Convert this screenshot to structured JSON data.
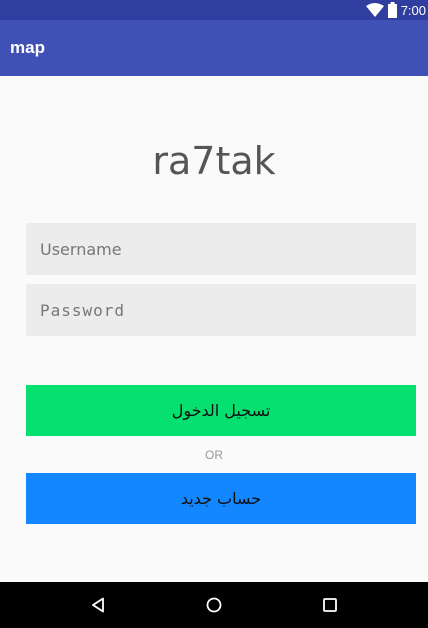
{
  "status_bar": {
    "time": "7:00",
    "icons": [
      "wifi-icon",
      "battery-icon"
    ]
  },
  "app_bar": {
    "title": "map"
  },
  "login": {
    "logo_text": "ra7tak",
    "username_placeholder": "Username",
    "password_placeholder": "Password",
    "login_button": "تسجيل الدخول",
    "or_label": "OR",
    "register_button": "حساب جديد"
  },
  "colors": {
    "status_bar": "#303f9f",
    "app_bar": "#3f51b5",
    "login_button": "#06e070",
    "register_button": "#1287ff",
    "field_background": "#ececec"
  },
  "nav_bar": {
    "buttons": [
      "back-icon",
      "home-icon",
      "recents-icon"
    ]
  }
}
